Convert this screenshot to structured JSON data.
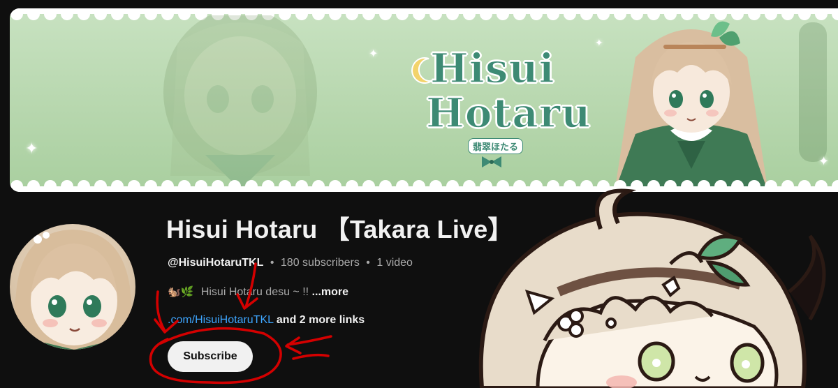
{
  "channel": {
    "title": "Hisui Hotaru 【Takara Live】",
    "handle": "@HisuiHotaruTKL",
    "separator": "•",
    "subscribers": "180 subscribers",
    "videos": "1 video",
    "description_emojis": "🐿️🌿",
    "description": "Hisui Hotaru desu ~ !!",
    "more_label": "...more",
    "link_text": ".com/HisuiHotaruTKL",
    "more_links": "and 2 more links",
    "subscribe_label": "Subscribe"
  },
  "banner": {
    "logo_line1": "Hisui",
    "logo_line2": "Hotaru",
    "logo_kana": "翡翠ほたる"
  },
  "colors": {
    "background": "#0f0f0f",
    "banner_green": "#b7d7ae",
    "logo_green": "#3d8a74",
    "link_blue": "#3ea6ff",
    "annotation_red": "#d40000",
    "subscribe_bg": "#f1f1f1"
  },
  "icons": [
    "sparkle-icon",
    "squirrel-emoji-icon",
    "herb-emoji-icon"
  ]
}
